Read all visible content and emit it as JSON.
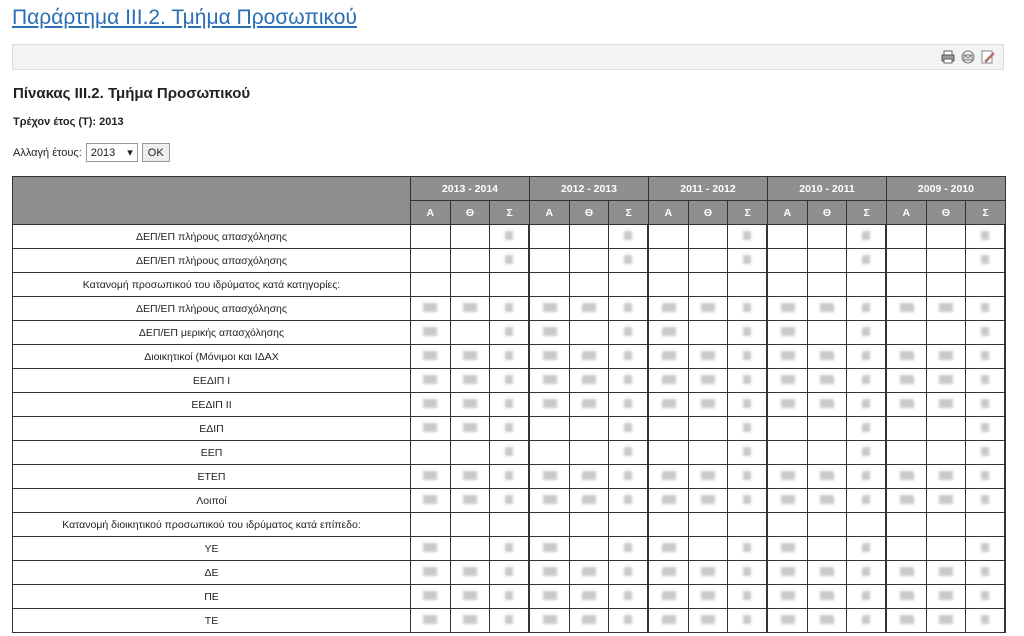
{
  "page_title": "Παράρτημα ΙΙΙ.2. Τμήμα Προσωπικού",
  "toolbar": {
    "icons": [
      "print-icon",
      "email-icon",
      "edit-icon"
    ]
  },
  "table_title": "Πίνακας ΙΙΙ.2. Τμήμα Προσωπικού",
  "current_year": "Τρέχον έτος (Τ): 2013",
  "year_change": {
    "label": "Αλλαγή έτους:",
    "selected": "2013",
    "ok": "OK"
  },
  "years": [
    "2013 - 2014",
    "2012 - 2013",
    "2011 - 2012",
    "2010 - 2011",
    "2009 - 2010"
  ],
  "subcols": [
    "Α",
    "Θ",
    "Σ"
  ],
  "rows": [
    {
      "label": "ΔΕΠ/ΕΠ πλήρους απασχόλησης",
      "pattern": "s"
    },
    {
      "label": "ΔΕΠ/ΕΠ πλήρους απασχόλησης",
      "pattern": "s"
    },
    {
      "label": "Κατανομή προσωπικού του ιδρύματος κατά κατηγορίες:",
      "pattern": "none"
    },
    {
      "label": "ΔΕΠ/ΕΠ πλήρους απασχόλησης",
      "pattern": "all"
    },
    {
      "label": "ΔΕΠ/ΕΠ μερικής απασχόλησης",
      "pattern": "mix"
    },
    {
      "label": "Διοικητικοί (Μόνιμοι και ΙΔΑΧ",
      "pattern": "all"
    },
    {
      "label": "ΕΕΔΙΠ Ι",
      "pattern": "all"
    },
    {
      "label": "ΕΕΔΙΠ ΙΙ",
      "pattern": "all"
    },
    {
      "label": "ΕΔΙΠ",
      "pattern": "first"
    },
    {
      "label": "ΕΕΠ",
      "pattern": "s"
    },
    {
      "label": "ΕΤΕΠ",
      "pattern": "all"
    },
    {
      "label": "Λοιποί",
      "pattern": "all"
    },
    {
      "label": "Κατανομή διοικητικού προσωπικού του ιδρύματος κατά επίπεδο:",
      "pattern": "none"
    },
    {
      "label": "ΥΕ",
      "pattern": "mix"
    },
    {
      "label": "ΔΕ",
      "pattern": "all"
    },
    {
      "label": "ΠΕ",
      "pattern": "all"
    },
    {
      "label": "ΤΕ",
      "pattern": "all"
    }
  ]
}
